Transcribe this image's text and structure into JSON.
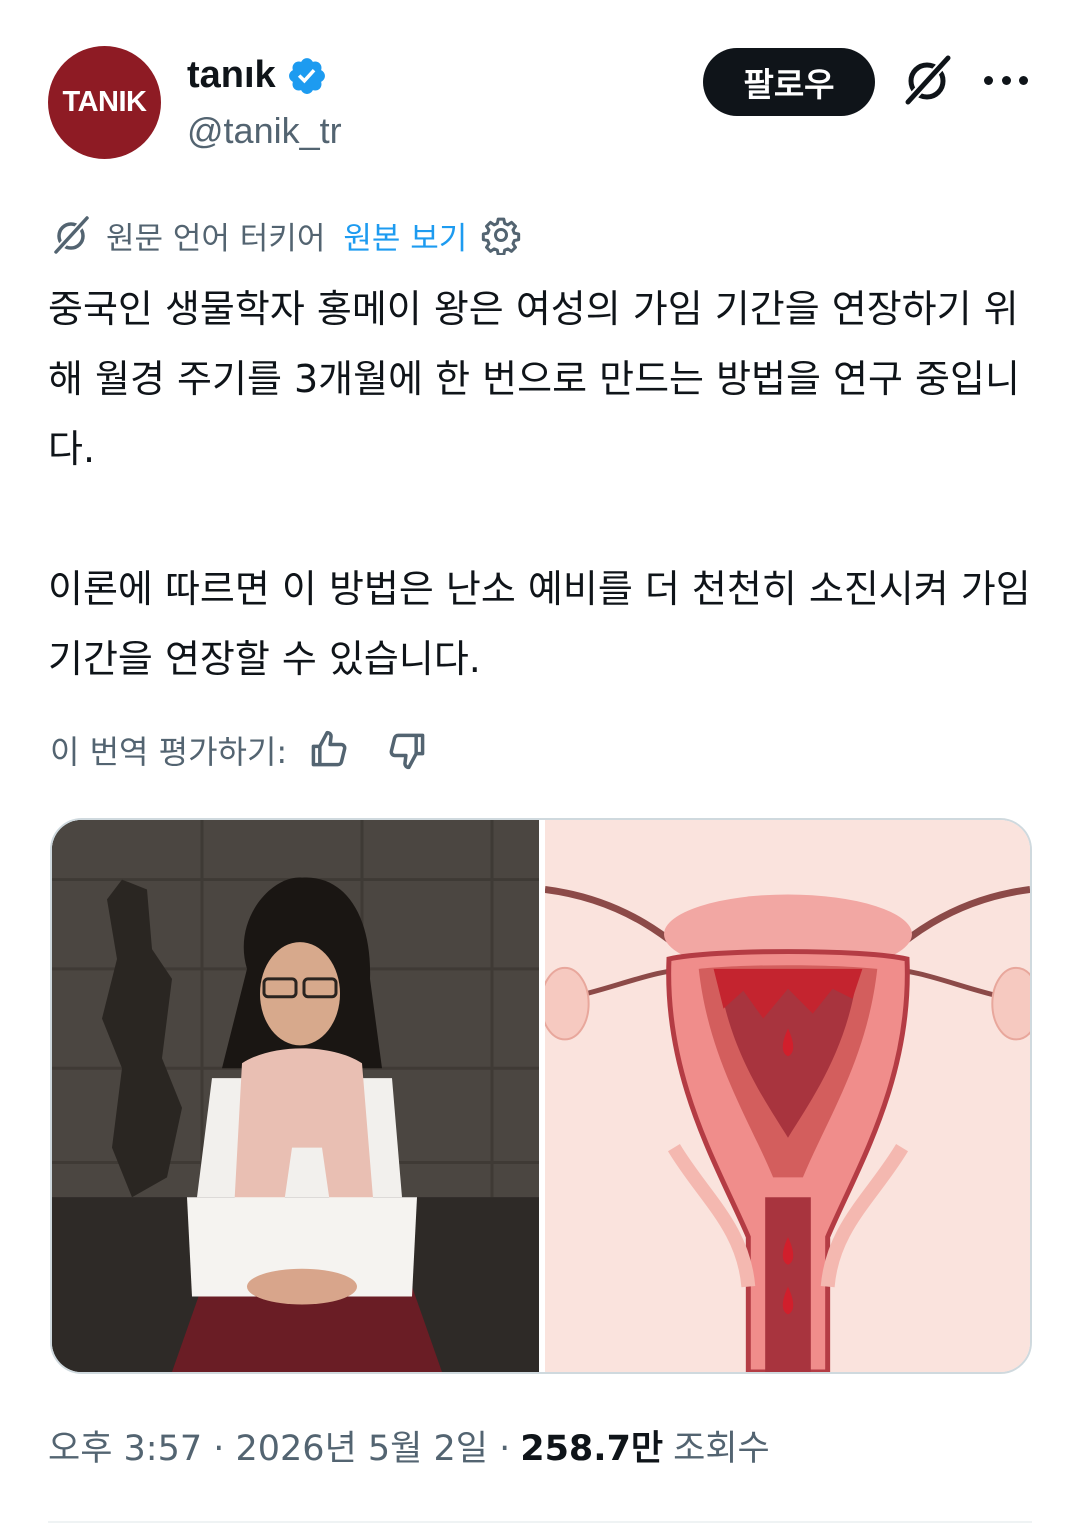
{
  "author": {
    "avatar_text": "TANIK",
    "display_name": "tanık",
    "handle": "@tanik_tr",
    "verified": true
  },
  "actions": {
    "follow_label": "팔로우",
    "grok_icon": "grok-icon",
    "more_icon": "more-icon"
  },
  "translation": {
    "source_language": "원문 언어 터키어",
    "show_original": "원본 보기",
    "rate_label": "이 번역 평가하기:"
  },
  "tweet": {
    "paragraphs": [
      "중국인 생물학자 홍메이 왕은 여성의 가임 기간을 연장하기 위해 월경 주기를 3개월에 한 번으로 만드는 방법을 연구 중입니다.",
      "이론에 따르면 이 방법은 난소 예비를 더 천천히 소진시켜 가임 기간을 연장할 수 있습니다."
    ]
  },
  "meta": {
    "time_date": "오후 3:57 · 2026년 5월 2일 · ",
    "views": "258.7만",
    "views_label": "조회수"
  },
  "colors": {
    "follow_bg": "#0f1419",
    "link": "#1d9bf0",
    "secondary_text": "#536471",
    "avatar_bg": "#8e1b24",
    "verified": "#1d9bf0"
  }
}
